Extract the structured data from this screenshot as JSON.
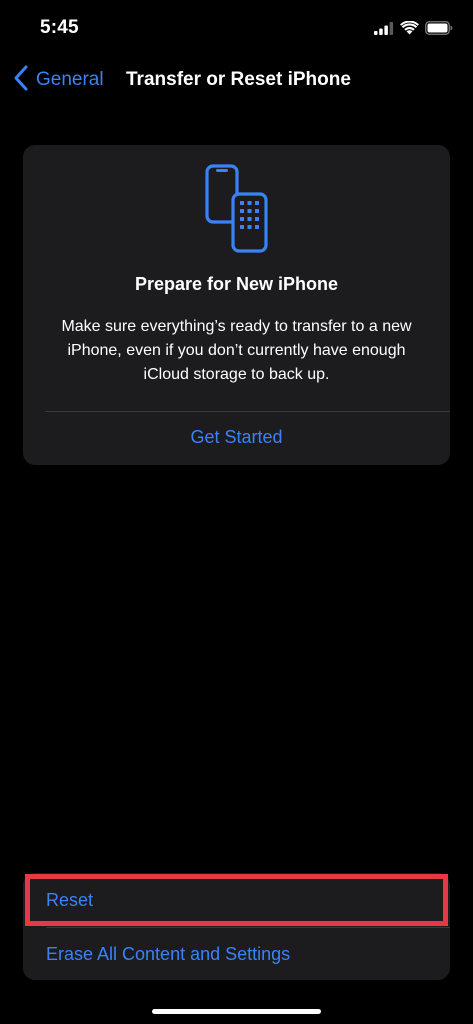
{
  "status_bar": {
    "time": "5:45",
    "icons": [
      "cellular-signal-icon",
      "wifi-icon",
      "battery-icon"
    ]
  },
  "nav": {
    "back_label": "General",
    "title": "Transfer or Reset iPhone"
  },
  "prepare_card": {
    "icon": "two-phones-icon",
    "title": "Prepare for New iPhone",
    "body": "Make sure everything’s ready to transfer to a new iPhone, even if you don’t currently have enough iCloud storage to back up.",
    "action_label": "Get Started"
  },
  "reset_group": {
    "reset_label": "Reset",
    "erase_label": "Erase All Content and Settings"
  },
  "colors": {
    "background": "#000000",
    "card": "#1c1c1e",
    "accent": "#3a82f7",
    "highlight": "#e63946"
  }
}
